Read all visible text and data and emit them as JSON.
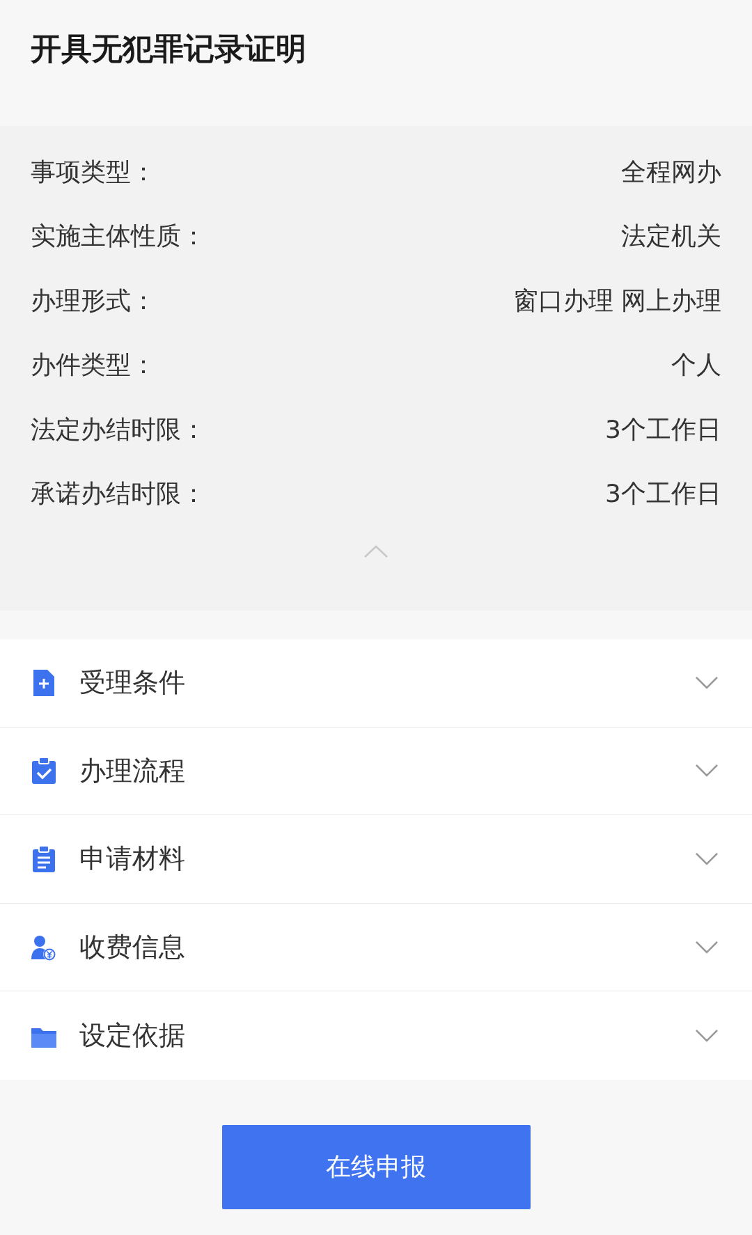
{
  "title": "开具无犯罪记录证明",
  "info": {
    "rows": [
      {
        "label": "事项类型：",
        "value": "全程网办"
      },
      {
        "label": "实施主体性质：",
        "value": "法定机关"
      },
      {
        "label": "办理形式：",
        "value": "窗口办理 网上办理"
      },
      {
        "label": "办件类型：",
        "value": "个人"
      },
      {
        "label": "法定办结时限：",
        "value": "3个工作日"
      },
      {
        "label": "承诺办结时限：",
        "value": "3个工作日"
      }
    ],
    "expanded": true
  },
  "sections": [
    {
      "kind": "conditions",
      "label": "受理条件",
      "expanded": false
    },
    {
      "kind": "process",
      "label": "办理流程",
      "expanded": false
    },
    {
      "kind": "materials",
      "label": "申请材料",
      "expanded": false
    },
    {
      "kind": "fees",
      "label": "收费信息",
      "expanded": false
    },
    {
      "kind": "basis",
      "label": "设定依据",
      "expanded": false
    }
  ],
  "submit_button": "在线申报"
}
